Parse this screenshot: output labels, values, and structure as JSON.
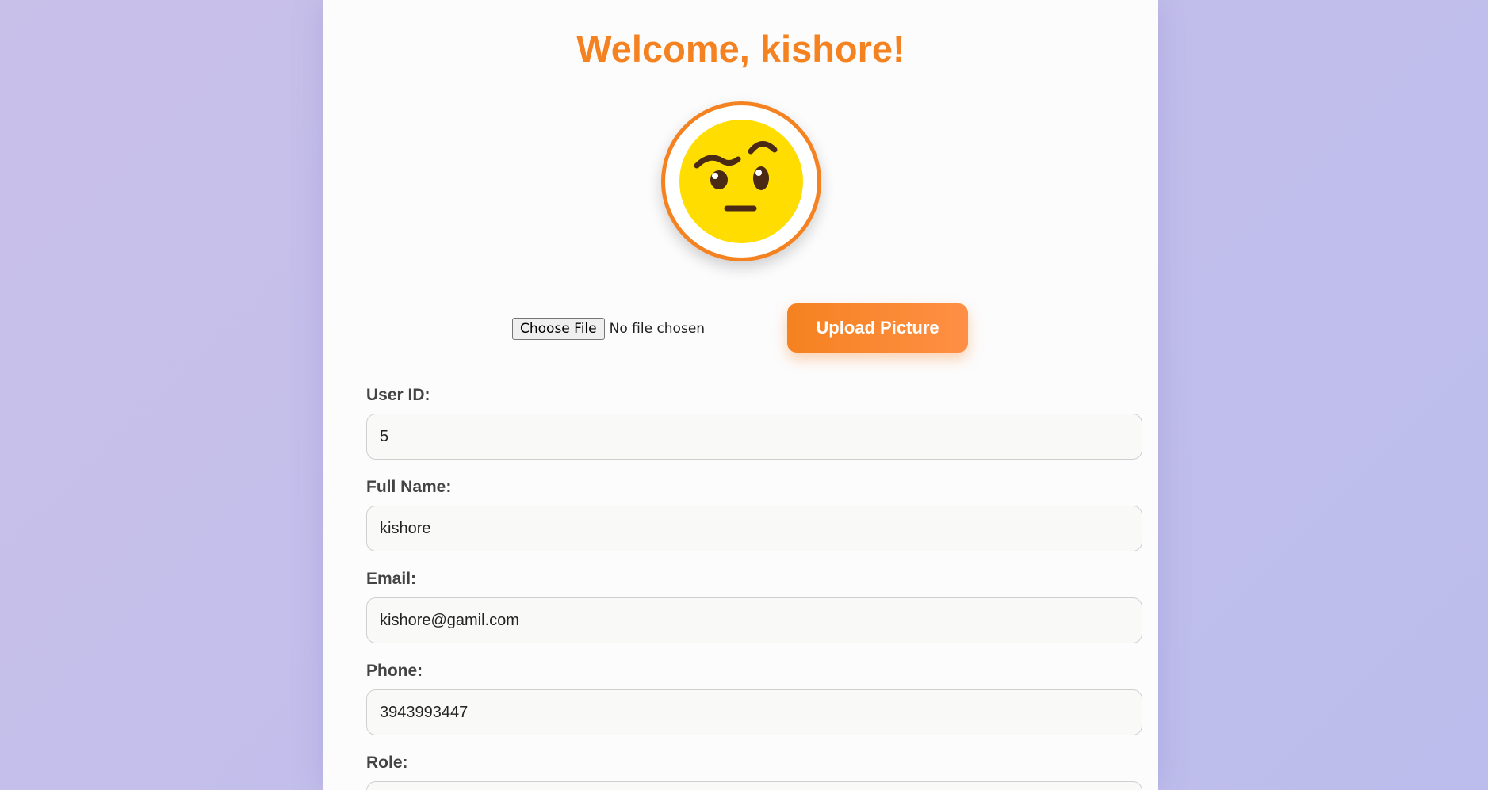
{
  "header": {
    "welcome": "Welcome, kishore!"
  },
  "avatar": {
    "icon": "raised-eyebrow-emoji-icon"
  },
  "upload": {
    "choose_label": "Choose File",
    "file_status": "No file chosen",
    "upload_label": "Upload Picture"
  },
  "fields": [
    {
      "label": "User ID:",
      "value": "5"
    },
    {
      "label": "Full Name:",
      "value": "kishore"
    },
    {
      "label": "Email:",
      "value": "kishore@gamil.com"
    },
    {
      "label": "Phone:",
      "value": "3943993447"
    },
    {
      "label": "Role:",
      "value": ""
    }
  ],
  "colors": {
    "accent": "#f58220",
    "background": "#c5c0eb",
    "card": "#fcfcfd"
  }
}
